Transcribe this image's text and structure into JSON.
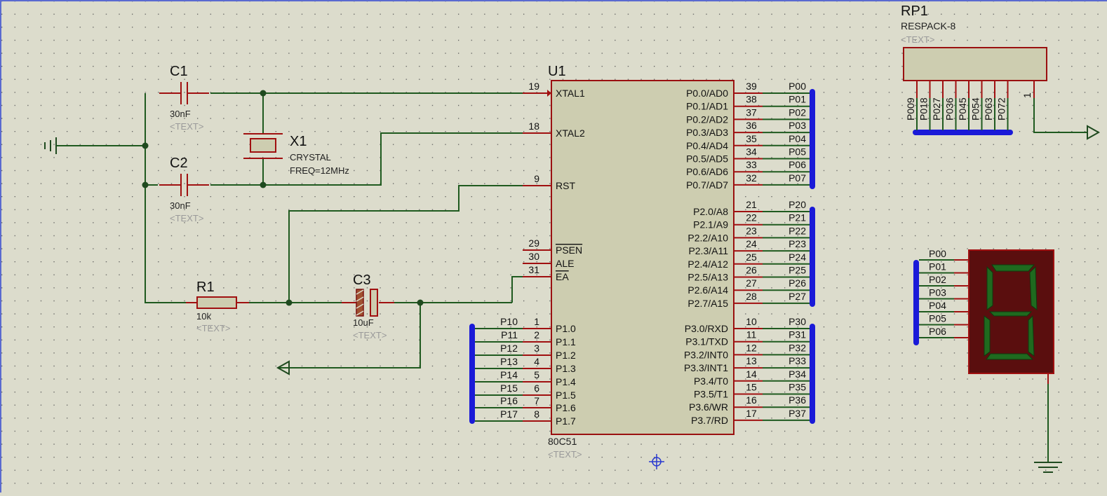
{
  "colors": {
    "background": "#dcdccc",
    "grid_dot": "#5a5a5a",
    "wire": "#1f5a1f",
    "pin": "#a01010",
    "bus": "#1a1ad8",
    "component_body": "#cdcdb0",
    "display_segment": "#1f6a1f",
    "display_body": "#5a0e0e"
  },
  "icons": {
    "ground": "ground-icon",
    "terminal": "terminal-arrow-icon",
    "cursor": "crosshair-cursor-icon"
  },
  "c1": {
    "ref": "C1",
    "value": "30nF",
    "text": "<TEXT>"
  },
  "c2": {
    "ref": "C2",
    "value": "30nF",
    "text": "<TEXT>"
  },
  "x1": {
    "ref": "X1",
    "type": "CRYSTAL",
    "freq": "FREQ=12MHz"
  },
  "r1": {
    "ref": "R1",
    "value": "10k",
    "text": "<TEXT>"
  },
  "c3": {
    "ref": "C3",
    "value": "10uF",
    "text": "<TEXT>"
  },
  "u1": {
    "ref": "U1",
    "part": "80C51",
    "text": "<TEXT>",
    "left_pins": [
      {
        "num": "19",
        "name": "XTAL1"
      },
      {
        "num": "18",
        "name": "XTAL2"
      },
      {
        "num": "9",
        "name": "RST"
      },
      {
        "num": "29",
        "name": "PSEN"
      },
      {
        "num": "30",
        "name": "ALE"
      },
      {
        "num": "31",
        "name": "EA"
      },
      {
        "num": "1",
        "name": "P1.0",
        "net": "P10"
      },
      {
        "num": "2",
        "name": "P1.1",
        "net": "P11"
      },
      {
        "num": "3",
        "name": "P1.2",
        "net": "P12"
      },
      {
        "num": "4",
        "name": "P1.3",
        "net": "P13"
      },
      {
        "num": "5",
        "name": "P1.4",
        "net": "P14"
      },
      {
        "num": "6",
        "name": "P1.5",
        "net": "P15"
      },
      {
        "num": "7",
        "name": "P1.6",
        "net": "P16"
      },
      {
        "num": "8",
        "name": "P1.7",
        "net": "P17"
      }
    ],
    "port0": [
      {
        "num": "39",
        "name": "P0.0/AD0",
        "net": "P00"
      },
      {
        "num": "38",
        "name": "P0.1/AD1",
        "net": "P01"
      },
      {
        "num": "37",
        "name": "P0.2/AD2",
        "net": "P02"
      },
      {
        "num": "36",
        "name": "P0.3/AD3",
        "net": "P03"
      },
      {
        "num": "35",
        "name": "P0.4/AD4",
        "net": "P04"
      },
      {
        "num": "34",
        "name": "P0.5/AD5",
        "net": "P05"
      },
      {
        "num": "33",
        "name": "P0.6/AD6",
        "net": "P06"
      },
      {
        "num": "32",
        "name": "P0.7/AD7",
        "net": "P07"
      }
    ],
    "port2": [
      {
        "num": "21",
        "name": "P2.0/A8",
        "net": "P20"
      },
      {
        "num": "22",
        "name": "P2.1/A9",
        "net": "P21"
      },
      {
        "num": "23",
        "name": "P2.2/A10",
        "net": "P22"
      },
      {
        "num": "24",
        "name": "P2.3/A11",
        "net": "P23"
      },
      {
        "num": "25",
        "name": "P2.4/A12",
        "net": "P24"
      },
      {
        "num": "26",
        "name": "P2.5/A13",
        "net": "P25"
      },
      {
        "num": "27",
        "name": "P2.6/A14",
        "net": "P26"
      },
      {
        "num": "28",
        "name": "P2.7/A15",
        "net": "P27"
      }
    ],
    "port3": [
      {
        "num": "10",
        "name": "P3.0/RXD",
        "net": "P30"
      },
      {
        "num": "11",
        "name": "P3.1/TXD",
        "net": "P31"
      },
      {
        "num": "12",
        "name": "P3.2/INT0",
        "net": "P32"
      },
      {
        "num": "13",
        "name": "P3.3/INT1",
        "net": "P33"
      },
      {
        "num": "14",
        "name": "P3.4/T0",
        "net": "P34"
      },
      {
        "num": "15",
        "name": "P3.5/T1",
        "net": "P35"
      },
      {
        "num": "16",
        "name": "P3.6/WR",
        "net": "P36"
      },
      {
        "num": "17",
        "name": "P3.7/RD",
        "net": "P37"
      }
    ]
  },
  "rp1": {
    "ref": "RP1",
    "part": "RESPACK-8",
    "text": "<TEXT>",
    "common_pin": "1",
    "pins": [
      "P009",
      "P018",
      "P027",
      "P036",
      "P045",
      "P054",
      "P063",
      "P072"
    ]
  },
  "display": {
    "nets": [
      "P00",
      "P01",
      "P02",
      "P03",
      "P04",
      "P05",
      "P06"
    ]
  }
}
